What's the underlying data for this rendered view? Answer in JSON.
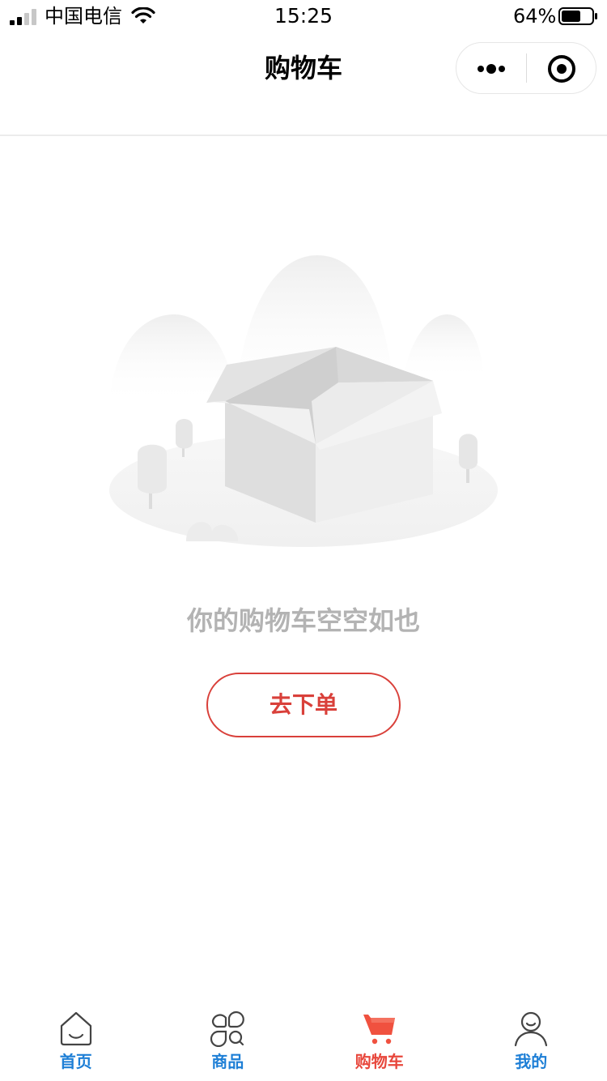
{
  "status_bar": {
    "carrier": "中国电信",
    "time": "15:25",
    "battery": "64%",
    "battery_level": 0.64,
    "signal_bars": 2
  },
  "nav": {
    "title": "购物车",
    "more_icon": "more-dots-icon",
    "close_icon": "target-circle-icon"
  },
  "empty_state": {
    "illustration": "empty-box-illustration",
    "message": "你的购物车空空如也",
    "button_label": "去下单"
  },
  "tab_bar": {
    "active_index": 2,
    "items": [
      {
        "label": "首页",
        "icon": "home-icon"
      },
      {
        "label": "商品",
        "icon": "products-icon"
      },
      {
        "label": "购物车",
        "icon": "cart-icon"
      },
      {
        "label": "我的",
        "icon": "profile-icon"
      }
    ]
  },
  "colors": {
    "accent_red": "#e8473c",
    "button_red": "#d9403a",
    "tab_blue": "#1e7fd6",
    "muted_text": "#b3b3b3"
  }
}
